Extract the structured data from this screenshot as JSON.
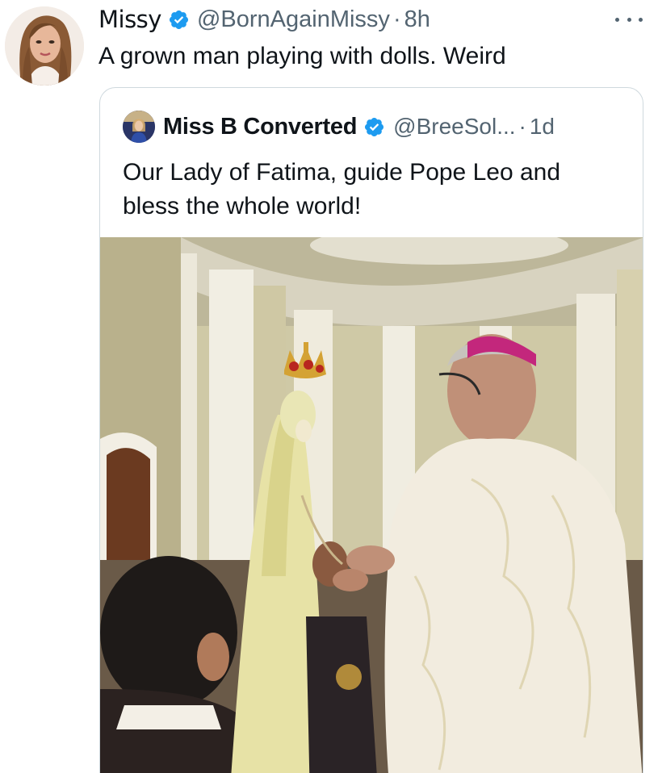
{
  "tweet": {
    "author_name": "Missy",
    "author_handle": "@BornAgainMissy",
    "separator": "·",
    "time": "8h",
    "text": "A grown man playing with dolls. Weird",
    "more_icon": "more-horizontal-icon",
    "verified_icon": "verified-badge-icon"
  },
  "quote": {
    "author_name": "Miss B Converted",
    "author_handle": "@BreeSol...",
    "separator": "·",
    "time": "1d",
    "text": "Our Lady of Fatima, guide Pope Leo and bless the whole world!",
    "verified_icon": "verified-badge-icon",
    "media": "photo of a bishop in white vestments and pink zucchetto before a crowned statue of Our Lady of Fatima in a church"
  },
  "colors": {
    "text": "#0f1419",
    "secondary": "#536471",
    "verified": "#1d9bf0",
    "border": "#cfd9de"
  }
}
